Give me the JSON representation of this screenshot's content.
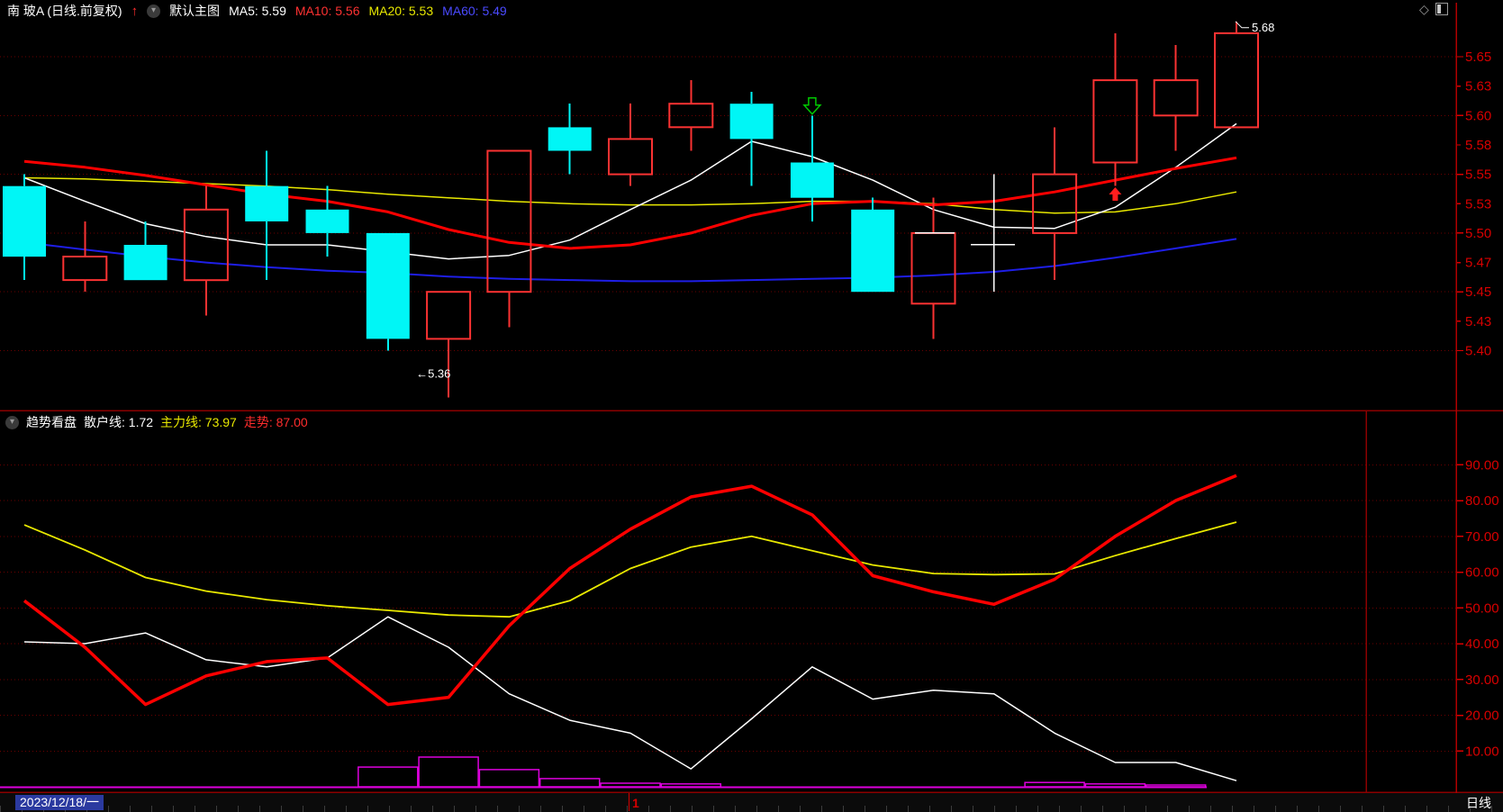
{
  "header": {
    "title": "南 玻A (日线.前复权)",
    "up_arrow_icon": "arrow-up",
    "dropdown_icon": "chevron-down",
    "overlay_label": "默认主图",
    "ma_labels": [
      {
        "text": "MA5: 5.59",
        "color": "#ffffff"
      },
      {
        "text": "MA10: 5.56",
        "color": "#ff3232"
      },
      {
        "text": "MA20: 5.53",
        "color": "#e8e800"
      },
      {
        "text": "MA60: 5.49",
        "color": "#4a4aff"
      }
    ],
    "window_icons": [
      "diamond-icon",
      "split-view-icon"
    ]
  },
  "main_chart": {
    "axis": [
      {
        "label": "5.65",
        "major": true
      },
      {
        "label": "5.63",
        "major": false
      },
      {
        "label": "5.60",
        "major": true
      },
      {
        "label": "5.58",
        "major": false
      },
      {
        "label": "5.55",
        "major": true
      },
      {
        "label": "5.53",
        "major": false
      },
      {
        "label": "5.50",
        "major": true
      },
      {
        "label": "5.47",
        "major": false
      },
      {
        "label": "5.45",
        "major": true
      },
      {
        "label": "5.43",
        "major": false
      },
      {
        "label": "5.40",
        "major": true
      }
    ],
    "high_annotation": "5.68",
    "low_annotation": "←5.36"
  },
  "indicator": {
    "header": {
      "dropdown_icon": "chevron-down",
      "name": "趋势看盘",
      "retail": "散户线: 1.72",
      "main_force": "主力线: 73.97",
      "trend": "走势: 87.00"
    },
    "axis": [
      "90.00",
      "80.00",
      "70.00",
      "60.00",
      "50.00",
      "40.00",
      "30.00",
      "20.00",
      "10.00"
    ]
  },
  "bottom_bar": {
    "date": "2023/12/18/一",
    "marker": "1",
    "period": "日线"
  },
  "colors": {
    "bull_hollow": "#fa3232",
    "bear_fill": "#00f6f6",
    "flat_candle": "#ffffff",
    "axis_text": "#d90000",
    "grid_dot": "#6a0000",
    "panel_border": "#8b0000",
    "axis_line": "#b00000",
    "magenta_bars": "#dd00dd",
    "sell_marker": "#00c800",
    "buy_marker": "#ff1e1e",
    "date_chip_bg": "#2b3aa0"
  },
  "chart_data": [
    {
      "type": "candlestick",
      "panel": "main",
      "title": "南 玻A (日线.前复权)",
      "ylim": [
        5.395,
        5.685
      ],
      "y_ticks": [
        "5.65",
        "5.63",
        "5.60",
        "5.58",
        "5.55",
        "5.53",
        "5.50",
        "5.47",
        "5.45",
        "5.43",
        "5.40"
      ],
      "open": [
        5.54,
        5.46,
        5.49,
        5.46,
        5.54,
        5.52,
        5.5,
        5.41,
        5.45,
        5.59,
        5.55,
        5.59,
        5.61,
        5.56,
        5.52,
        5.44,
        5.5,
        5.5,
        5.56,
        5.6,
        5.59
      ],
      "high": [
        5.55,
        5.51,
        5.51,
        5.54,
        5.57,
        5.54,
        5.5,
        5.45,
        5.57,
        5.61,
        5.61,
        5.63,
        5.62,
        5.6,
        5.53,
        5.53,
        5.55,
        5.59,
        5.67,
        5.66,
        5.68
      ],
      "low": [
        5.46,
        5.45,
        5.46,
        5.43,
        5.46,
        5.48,
        5.4,
        5.36,
        5.42,
        5.55,
        5.54,
        5.57,
        5.54,
        5.51,
        5.45,
        5.41,
        5.45,
        5.46,
        5.54,
        5.57,
        5.59
      ],
      "close": [
        5.48,
        5.48,
        5.46,
        5.52,
        5.51,
        5.5,
        5.41,
        5.45,
        5.57,
        5.57,
        5.58,
        5.61,
        5.58,
        5.53,
        5.45,
        5.5,
        5.49,
        5.55,
        5.63,
        5.63,
        5.67
      ],
      "overlays": [
        {
          "name": "MA5",
          "color": "#ffffff",
          "width": 1.5,
          "values": [
            5.547,
            5.527,
            5.508,
            5.497,
            5.49,
            5.49,
            5.484,
            5.478,
            5.481,
            5.494,
            5.52,
            5.545,
            5.578,
            5.565,
            5.545,
            5.52,
            5.505,
            5.504,
            5.522,
            5.556,
            5.593
          ]
        },
        {
          "name": "MA10",
          "color": "#ff0000",
          "width": 3,
          "values": [
            5.561,
            5.556,
            5.549,
            5.541,
            5.533,
            5.527,
            5.518,
            5.503,
            5.492,
            5.487,
            5.49,
            5.5,
            5.515,
            5.525,
            5.527,
            5.524,
            5.527,
            5.535,
            5.545,
            5.555,
            5.564
          ]
        },
        {
          "name": "MA20",
          "color": "#e8e800",
          "width": 1.5,
          "values": [
            5.547,
            5.546,
            5.544,
            5.542,
            5.54,
            5.537,
            5.533,
            5.53,
            5.527,
            5.525,
            5.524,
            5.524,
            5.525,
            5.527,
            5.527,
            5.525,
            5.52,
            5.517,
            5.518,
            5.525,
            5.535
          ]
        },
        {
          "name": "MA60",
          "color": "#1e1ee6",
          "width": 2,
          "values": [
            5.492,
            5.486,
            5.48,
            5.475,
            5.471,
            5.468,
            5.466,
            5.463,
            5.461,
            5.46,
            5.459,
            5.459,
            5.46,
            5.461,
            5.462,
            5.464,
            5.467,
            5.472,
            5.479,
            5.487,
            5.495
          ]
        }
      ],
      "markers": [
        {
          "type": "sell-arrow",
          "color": "#00c800",
          "index": 13,
          "price": 5.615
        },
        {
          "type": "buy-arrow",
          "color": "#ff1e1e",
          "index": 18,
          "price": 5.539
        }
      ],
      "annotations": [
        {
          "text": "5.68",
          "index": 20,
          "price": 5.68,
          "dx": 17,
          "dy": 11,
          "hook": true
        },
        {
          "text": "←5.36",
          "index": 7,
          "price": 5.36,
          "dx": -36,
          "dy": -22,
          "hook": false
        }
      ]
    },
    {
      "type": "line",
      "panel": "indicator",
      "name": "趋势看盘",
      "ylim": [
        0,
        100
      ],
      "y_ticks": [
        "90.00",
        "80.00",
        "70.00",
        "60.00",
        "50.00",
        "40.00",
        "30.00",
        "20.00",
        "10.00"
      ],
      "series": [
        {
          "name": "主力线",
          "color": "#e8e800",
          "width": 1.8,
          "last": 73.97,
          "values": [
            73.2,
            66.2,
            58.5,
            54.7,
            52.3,
            50.6,
            49.3,
            48.0,
            47.5,
            52.0,
            61.0,
            67.0,
            70.0,
            66.0,
            62.0,
            59.6,
            59.3,
            59.5,
            64.6,
            69.4,
            73.97
          ]
        },
        {
          "name": "散户线",
          "color": "#ffffff",
          "width": 1.5,
          "last": 1.72,
          "values": [
            40.5,
            40.0,
            43.0,
            35.5,
            33.5,
            36.0,
            47.5,
            39.0,
            26.0,
            18.6,
            15.0,
            5.0,
            19.0,
            33.5,
            24.5,
            27.0,
            26.0,
            15.0,
            6.8,
            6.8,
            1.72
          ]
        },
        {
          "name": "走势",
          "color": "#ff0000",
          "width": 3.5,
          "last": 87.0,
          "values": [
            52,
            39,
            23,
            31,
            35,
            36,
            23,
            25,
            45,
            61,
            72,
            81,
            84,
            76,
            59,
            54.5,
            51,
            58,
            70,
            80,
            87
          ]
        }
      ],
      "bars": {
        "name": "能量柱",
        "color": "#dd00dd",
        "values": [
          0,
          0,
          0,
          0,
          0,
          0,
          5.5,
          8.3,
          4.8,
          2.3,
          1.0,
          0.8,
          0,
          0,
          0,
          0,
          0,
          1.2,
          0.8,
          0.5,
          0
        ]
      },
      "baseline_end_x": 1340
    }
  ]
}
